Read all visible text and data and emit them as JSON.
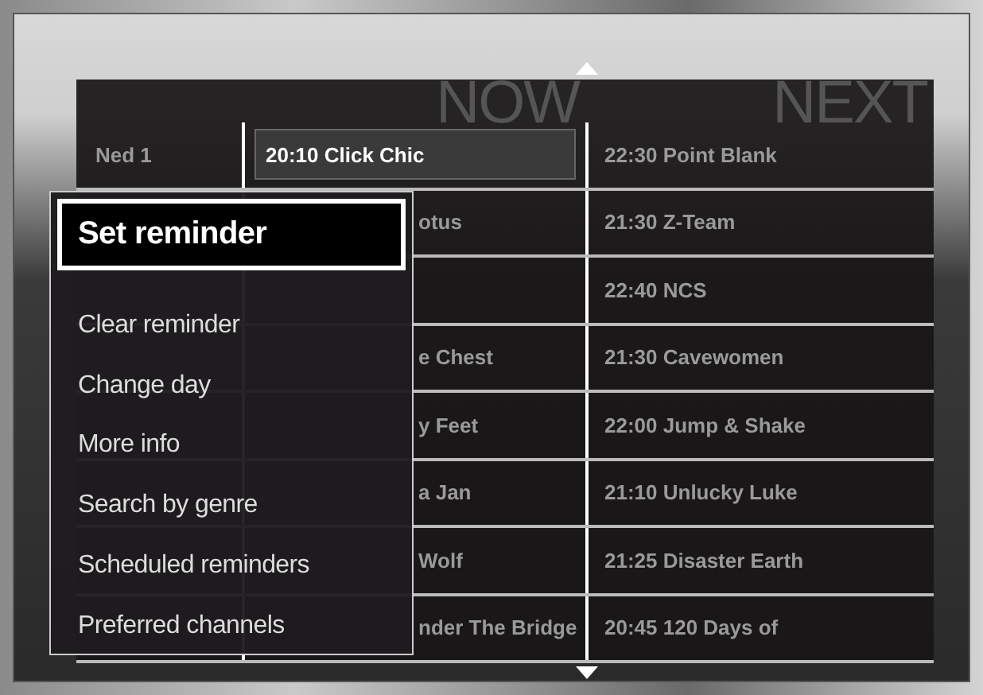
{
  "guide": {
    "headers": [
      "NOW",
      "NEXT"
    ],
    "rows": [
      {
        "kind": "open",
        "selected": true,
        "channel": "Ned 1",
        "now": "20:10 Click Chic",
        "next": "22:30 Point Blank"
      },
      {
        "kind": "covered",
        "selected": false,
        "now": "otus",
        "next": "21:30 Z-Team"
      },
      {
        "kind": "covered",
        "selected": false,
        "next": "22:40 NCS"
      },
      {
        "kind": "covered",
        "selected": false,
        "now": "e Chest",
        "next": "21:30 Cavewomen"
      },
      {
        "kind": "covered",
        "selected": false,
        "now": "y Feet",
        "next": "22:00 Jump & Shake"
      },
      {
        "kind": "covered",
        "selected": false,
        "now": "a Jan",
        "next": "21:10 Unlucky Luke"
      },
      {
        "kind": "covered",
        "selected": false,
        "now": "Wolf",
        "next": "21:25 Disaster Earth"
      },
      {
        "kind": "covered",
        "selected": false,
        "now": "nder The Bridge",
        "next": "20:45 120 Days of"
      }
    ]
  },
  "menu": {
    "items": [
      {
        "label": "Set reminder",
        "selected": true
      },
      {
        "label": "Clear reminder",
        "selected": false
      },
      {
        "label": "Change day",
        "selected": false
      },
      {
        "label": "More info",
        "selected": false
      },
      {
        "label": "Search by genre",
        "selected": false
      },
      {
        "label": "Scheduled reminders",
        "selected": false
      },
      {
        "label": "Preferred channels",
        "selected": false
      }
    ]
  }
}
